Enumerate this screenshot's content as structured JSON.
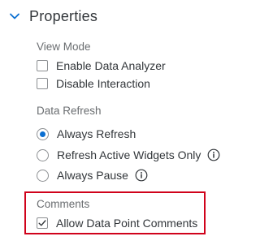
{
  "panel": {
    "title": "Properties",
    "collapse_icon": "chevron-down-icon"
  },
  "view_mode": {
    "label": "View Mode",
    "options": [
      {
        "label": "Enable Data Analyzer",
        "checked": false
      },
      {
        "label": "Disable Interaction",
        "checked": false
      }
    ]
  },
  "data_refresh": {
    "label": "Data Refresh",
    "options": [
      {
        "label": "Always Refresh",
        "selected": true,
        "info": false
      },
      {
        "label": "Refresh Active Widgets Only",
        "selected": false,
        "info": true
      },
      {
        "label": "Always Pause",
        "selected": false,
        "info": true
      }
    ]
  },
  "comments": {
    "label": "Comments",
    "options": [
      {
        "label": "Allow Data Point Comments",
        "checked": true
      }
    ],
    "highlight_color": "#d0021b"
  },
  "colors": {
    "accent": "#0a6ed1",
    "text": "#32363a",
    "muted": "#6a6d70",
    "control_border": "#8c8f92"
  },
  "icons": {
    "info": "info-icon",
    "check": "checkmark-icon"
  }
}
